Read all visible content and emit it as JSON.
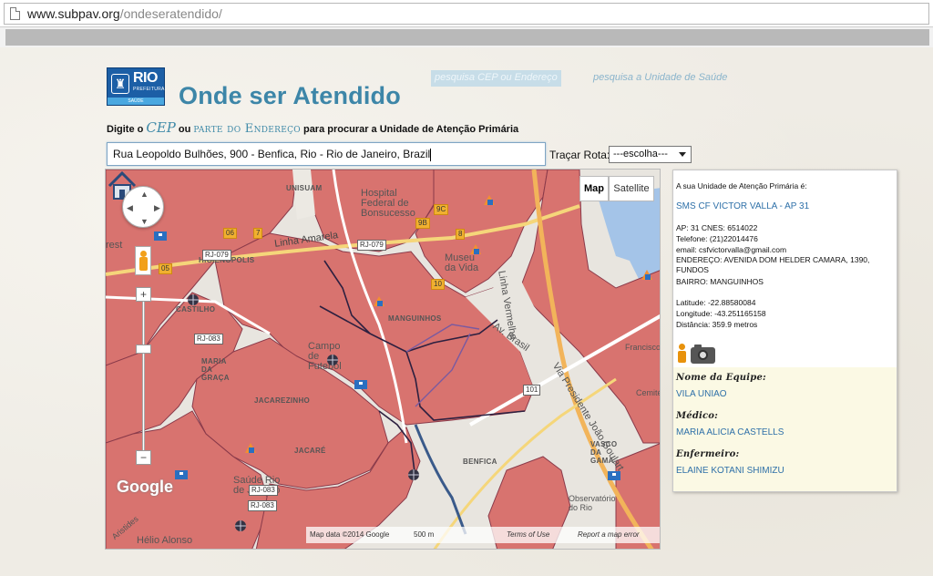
{
  "browser": {
    "url_domain": "www.subpav.org",
    "url_path": "/ondeseratendido/"
  },
  "header": {
    "logo": {
      "rio": "RIO",
      "prefeitura": "PREFEITURA",
      "saude": "SAÚDE"
    },
    "title": "Onde ser Atendido",
    "link_cep": "pesquisa CEP ou Endereço",
    "link_unidade": "pesquisa a Unidade de Saúde"
  },
  "instructions": {
    "prefix": "Digite o",
    "cep": "CEP",
    "ou": "ou",
    "parte": "parte do Endereço",
    "suffix": "para procurar a Unidade de Atenção Primária"
  },
  "search": {
    "address_value": "Rua Leopoldo Bulhões, 900 - Benfica, Rio - Rio de Janeiro, Brazil",
    "rota_label": "Traçar Rota:",
    "rota_selected": "---escolha---"
  },
  "map": {
    "type_map": "Map",
    "type_satellite": "Satellite",
    "labels": {
      "unisuam": "UNISUAM",
      "hospital": "Hospital Federal de Bonsucesso",
      "linha_amarela": "Linha Amarela",
      "higienopolis": "HIGIENÓPOLIS",
      "castelo": "CASTILHO",
      "manguinhos": "MANGUINHOS",
      "museu": "Museu da Vida",
      "linha_vermelha": "Linha Vermelha",
      "jacarezinho": "JACAREZINHO",
      "jacare": "JACARÉ",
      "benfica": "BENFICA",
      "vasco": "VASCO DA GAMA",
      "campo": "Campo de Futebol",
      "maria_graca": "MARIA DA GRAÇA",
      "via_presidente": "Via Presidente João Goulart",
      "av_brasil": "Av. Brasil",
      "hospital_saude": "Saúde Rio de Janeiro",
      "observatorio": "Observatório do Rio",
      "helio": "Hélio Alonso",
      "artistides": "Aristides",
      "rest": "rest",
      "cemiterio": "Cemitério",
      "francisco": "Francisco"
    },
    "shields": [
      "RJ-079",
      "RJ-083",
      "RJ-083",
      "RJ-083",
      "RJ-079",
      "06",
      "7",
      "05",
      "9B",
      "9C",
      "10",
      "8",
      "101",
      "RJ-083"
    ],
    "attribution": "Map data ©2014 Google",
    "scale": "500 m",
    "terms": "Terms of Use",
    "report": "Report a map error",
    "google_logo": "Google"
  },
  "panel": {
    "heading": "A sua Unidade de Atenção Primária é:",
    "unit_name": "SMS CF VICTOR VALLA - AP 31",
    "ap_cnes": "AP: 31 CNES: 6514022",
    "telefone": "Telefone: (21)22014476",
    "email": "email: csfvictorvalla@gmail.com",
    "endereco": "ENDEREÇO: AVENIDA DOM HELDER CAMARA, 1390, FUNDOS",
    "bairro": "BAIRRO: MANGUINHOS",
    "latitude": "Latitude: -22.88580084",
    "longitude": "Longitude: -43.251165158",
    "distancia": "Distância: 359.9 metros",
    "team_label": "Nome da Equipe:",
    "team_value": "VILA UNIAO",
    "medico_label": "Médico:",
    "medico_value": "MARIA ALICIA CASTELLS",
    "enfermeiro_label": "Enfermeiro:",
    "enfermeiro_value": "ELAINE KOTANI SHIMIZU"
  },
  "colors": {
    "title": "#3d86a8",
    "link": "#2e70a8",
    "region_fill": "#d8736f",
    "region_border": "#2a2a4a"
  }
}
